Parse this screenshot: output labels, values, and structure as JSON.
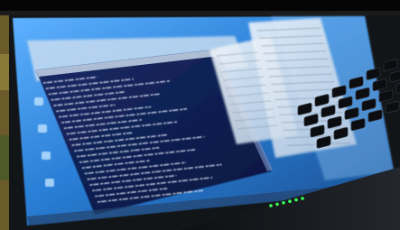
{
  "photo": {
    "subject": "laptop-screen-photo",
    "colors": {
      "background_dark": "#0b0b0b",
      "left_strip": "#6b5a2a",
      "screen_glow": "#2a7fd6",
      "terminal_bg": "#0f1c4a",
      "window_light": "#dfe8f2",
      "keyboard": "#16181c",
      "led_green": "#39ff5a",
      "bezel": "#111418"
    },
    "desktop_icons": [
      "icon-1",
      "icon-2",
      "icon-3",
      "icon-4"
    ],
    "led_count": 6
  }
}
